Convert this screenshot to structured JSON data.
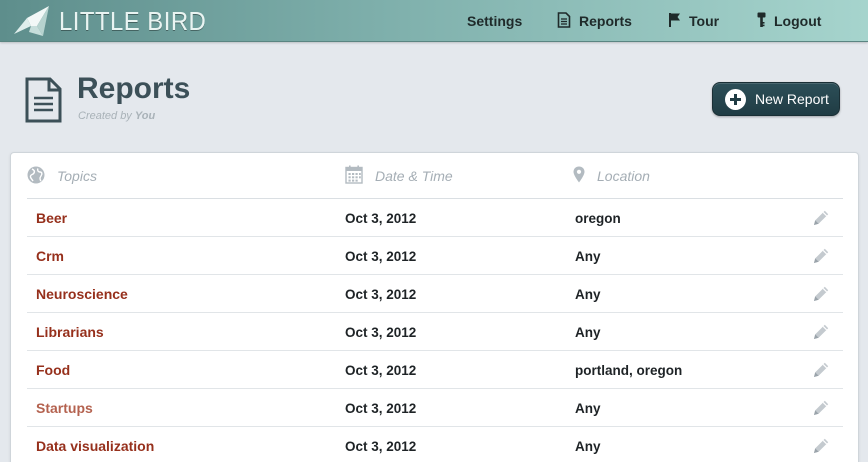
{
  "app": {
    "logo_text": "LITTLE BIRD"
  },
  "nav": {
    "settings": "Settings",
    "reports": "Reports",
    "tour": "Tour",
    "logout": "Logout"
  },
  "page": {
    "title": "Reports",
    "subtitle_prefix": "Created by",
    "subtitle_owner": "You",
    "new_report_label": "New Report"
  },
  "table": {
    "columns": {
      "topics": "Topics",
      "date": "Date & Time",
      "location": "Location"
    },
    "rows": [
      {
        "topic": "Beer",
        "date": "Oct 3, 2012",
        "location": "oregon"
      },
      {
        "topic": "Crm",
        "date": "Oct 3, 2012",
        "location": "Any"
      },
      {
        "topic": "Neuroscience",
        "date": "Oct 3, 2012",
        "location": "Any"
      },
      {
        "topic": "Librarians",
        "date": "Oct 3, 2012",
        "location": "Any"
      },
      {
        "topic": "Food",
        "date": "Oct 3, 2012",
        "location": "portland, oregon"
      },
      {
        "topic": "Startups",
        "date": "Oct 3, 2012",
        "location": "Any"
      },
      {
        "topic": "Data visualization",
        "date": "Oct 3, 2012",
        "location": "Any"
      }
    ]
  },
  "colors": {
    "header_from": "#5e8e8c",
    "header_to": "#a6d4cd",
    "topic_link": "#96301c",
    "button_bg": "#203c44"
  },
  "icons": {
    "logo": "paper-crane-icon",
    "reports_nav": "document-icon",
    "tour_nav": "flag-icon",
    "logout_nav": "key-icon",
    "page_title": "document-icon",
    "new_report": "plus-circle-icon",
    "topics_col": "globe-icon",
    "date_col": "calendar-icon",
    "location_col": "map-pin-icon",
    "row_action": "pencil-icon"
  }
}
